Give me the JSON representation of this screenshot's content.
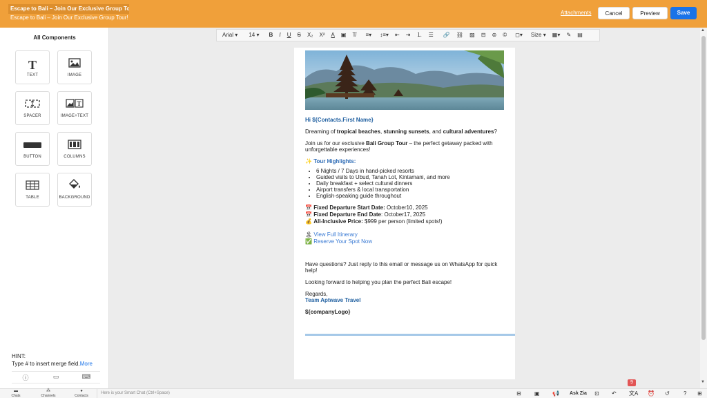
{
  "header": {
    "subject_value": "Escape to Bali – Join Our Exclusive Group To",
    "subject_preview": "Escape to Bali – Join Our Exclusive Group Tour!",
    "attachments_label": "Attachments",
    "cancel_label": "Cancel",
    "preview_label": "Preview",
    "save_label": "Save",
    "accent_color": "#f0a03a",
    "save_color": "#1a73e8"
  },
  "sidebar": {
    "title": "All Components",
    "components": [
      {
        "label": "TEXT",
        "icon": "text-icon"
      },
      {
        "label": "IMAGE",
        "icon": "image-icon"
      },
      {
        "label": "SPACER",
        "icon": "spacer-icon"
      },
      {
        "label": "IMAGE+TEXT",
        "icon": "image-text-icon"
      },
      {
        "label": "BUTTON",
        "icon": "button-icon"
      },
      {
        "label": "COLUMNS",
        "icon": "columns-icon"
      },
      {
        "label": "TABLE",
        "icon": "table-icon"
      },
      {
        "label": "BACKGROUND",
        "icon": "paint-bucket-icon"
      }
    ],
    "hint_title": "HINT:",
    "hint_text": "Type # to insert merge field.",
    "hint_more": "More"
  },
  "toolbar": {
    "font_family": "Arial",
    "font_size": "14",
    "size_label": "Size"
  },
  "email": {
    "greeting": "Hi ${Contacts.First Name}",
    "p1_a": "Dreaming of ",
    "p1_b": "tropical beaches",
    "p1_c": ", ",
    "p1_d": "stunning sunsets",
    "p1_e": ", and ",
    "p1_f": "cultural adventures",
    "p1_g": "?",
    "p2_a": "Join us for our exclusive ",
    "p2_b": "Bali Group Tour",
    "p2_c": " – the perfect getaway packed with unforgettable experiences!",
    "highlights_emoji": "✨",
    "highlights_title": "Tour Highlights:",
    "highlights": [
      "6 Nights / 7 Days in hand-picked resorts",
      "Guided visits to Ubud, Tanah Lot, Kintamani, and more",
      "Daily breakfast + select cultural dinners",
      "Airport transfers & local transportation",
      "English-speaking guide throughout"
    ],
    "start_label": "Fixed Departure Start Date:",
    "start_value": " October10, 2025",
    "end_label": "Fixed Departure End Date",
    "end_value": ": October17, 2025",
    "price_label": "All-Inclusive Price:",
    "price_value": " $999 per person (limited spots!)",
    "itinerary_link": "View Full Itinerary",
    "reserve_link": "Reserve Your Spot Now",
    "questions": "Have questions? Just reply to this email or message us on WhatsApp for quick help!",
    "looking_forward": "Looking forward to helping you plan the perfect Bali escape!",
    "regards": "Regards,",
    "team": "Team Aptwave Travel",
    "company_logo": "${companyLogo}"
  },
  "bottom": {
    "chats": "Chats",
    "channels": "Channels",
    "contacts": "Contacts",
    "smart_chat_placeholder": "Here is your Smart Chat (Ctrl+Space)",
    "ask_zia": "Ask Zia",
    "notification_count": "9"
  }
}
